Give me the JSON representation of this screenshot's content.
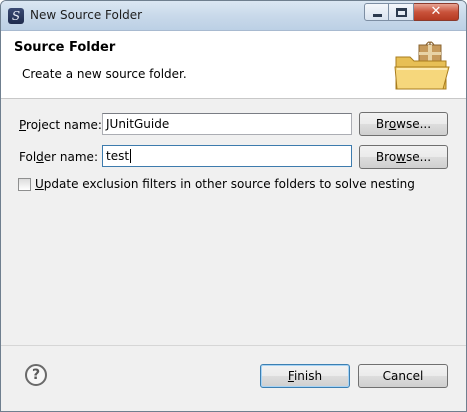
{
  "window": {
    "title": "New Source Folder"
  },
  "banner": {
    "title": "Source Folder",
    "description": "Create a new source folder."
  },
  "form": {
    "project_label_pre": "",
    "project_label_mnemonic": "P",
    "project_label_post": "roject name:",
    "project_value": "JUnitGuide",
    "folder_label_pre": "Fol",
    "folder_label_mnemonic": "d",
    "folder_label_post": "er name:",
    "folder_value": "test",
    "browse_pre": "Br",
    "browse_mnemonic": "o",
    "browse_post": "wse...",
    "browse2_pre": "Bro",
    "browse2_mnemonic": "w",
    "browse2_post": "se...",
    "checkbox_checked": false,
    "checkbox_mnemonic": "U",
    "checkbox_label_post": "pdate exclusion filters in other source folders to solve nesting"
  },
  "footer": {
    "help_icon": "help-icon",
    "finish_mnemonic": "F",
    "finish_post": "inish",
    "cancel_label": "Cancel"
  },
  "colors": {
    "window_bg": "#f0f0f0",
    "banner_bg": "#ffffff",
    "default_button_border": "#3c7fb1",
    "close_button": "#c9533b"
  }
}
